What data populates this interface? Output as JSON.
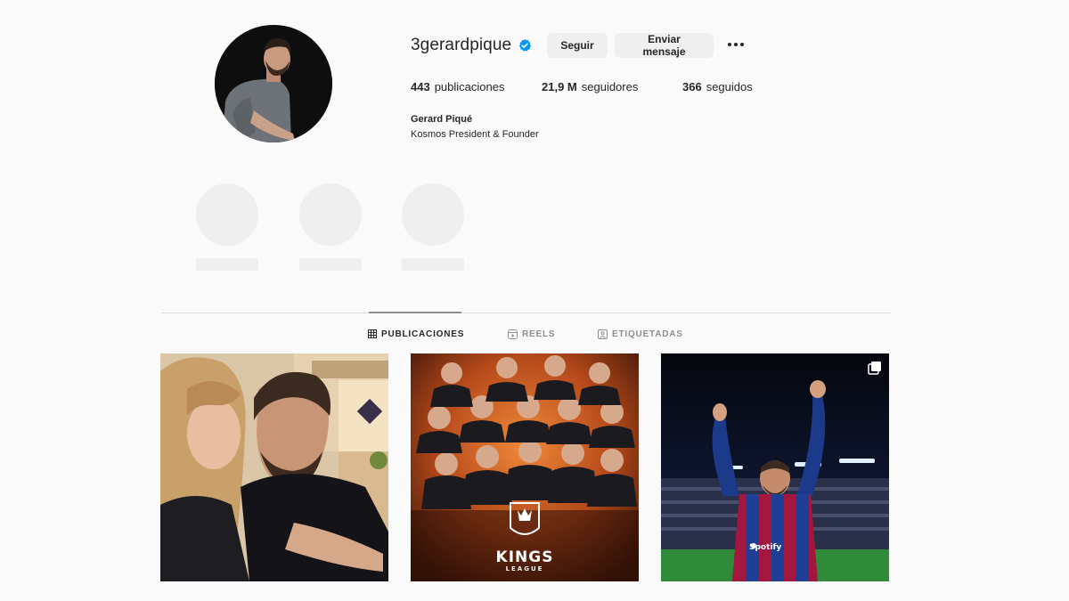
{
  "profile": {
    "username": "3gerardpique",
    "verified": true,
    "follow_label": "Seguir",
    "message_label": "Enviar mensaje",
    "posts_count": "443",
    "posts_label": "publicaciones",
    "followers_count": "21,9 M",
    "followers_label": "seguidores",
    "following_count": "366",
    "following_label": "seguidos",
    "full_name": "Gerard Piqué",
    "bio": "Kosmos President & Founder"
  },
  "tabs": [
    {
      "label": "PUBLICACIONES",
      "icon": "grid-icon",
      "active": true
    },
    {
      "label": "REELS",
      "icon": "reels-icon",
      "active": false
    },
    {
      "label": "ETIQUETADAS",
      "icon": "tagged-icon",
      "active": false
    }
  ],
  "posts": [
    {
      "kind": "photo",
      "icon": "couple-selfie-photo"
    },
    {
      "kind": "photo",
      "icon": "kings-league-poster",
      "overlay_title": "KINGS",
      "overlay_subtitle": "LEAGUE"
    },
    {
      "kind": "carousel",
      "icon": "stadium-celebration-photo",
      "sponsor_text": "Spotify"
    }
  ],
  "colors": {
    "background": "#fafafa",
    "text": "#262626",
    "muted": "#8e8e8e",
    "button_bg": "#efefef",
    "verified_blue": "#0095f6",
    "placeholder": "#efefef"
  }
}
